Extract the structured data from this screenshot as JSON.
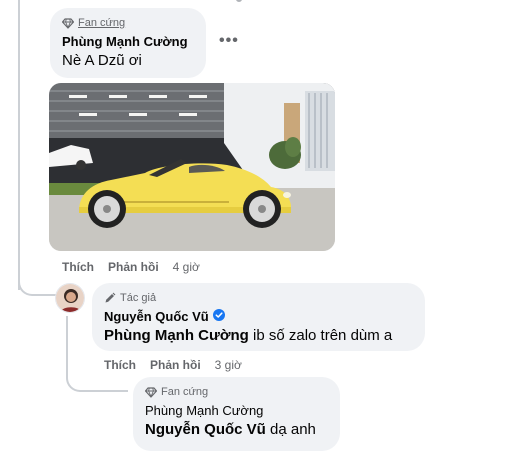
{
  "comment1": {
    "badge": "Fan cứng",
    "author": "Phùng Mạnh Cường",
    "text": "Nè A Dzũ ơi",
    "more_label": "•••",
    "actions": {
      "like": "Thích",
      "reply": "Phản hồi",
      "time": "4 giờ"
    }
  },
  "reply1": {
    "badge": "Tác giả",
    "author": "Nguyễn Quốc Vũ",
    "mention": "Phùng Mạnh Cường",
    "text": " ib số zalo trên dùm a",
    "actions": {
      "like": "Thích",
      "reply": "Phản hồi",
      "time": "3 giờ"
    }
  },
  "reply2": {
    "badge": "Fan cứng",
    "author": "Phùng Mạnh Cường",
    "mention": "Nguyễn Quốc Vũ",
    "text": " dạ anh"
  },
  "colors": {
    "bubble": "#f0f2f5",
    "secondary_text": "#65676b",
    "verified": "#1877f2",
    "car": "#f4de54"
  }
}
